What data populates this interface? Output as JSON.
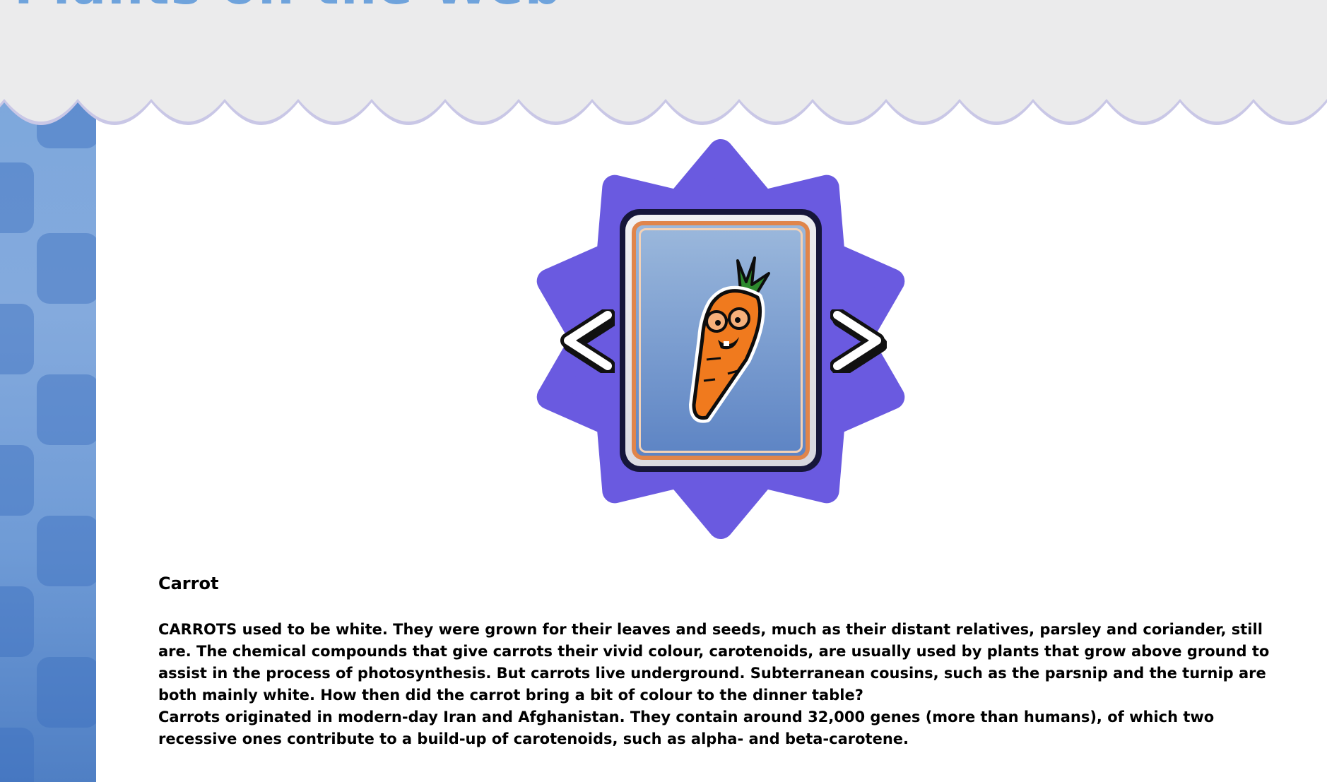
{
  "header": {
    "title": "Plants on the Web"
  },
  "gallery": {
    "prev_label": "<",
    "next_label": ">",
    "current_image": "carrot-character-icon",
    "star_color": "#6a5ae0"
  },
  "item": {
    "title": "Carrot",
    "paragraphs": [
      "CARROTS used to be white. They were grown for their leaves and seeds, much as their distant relatives, parsley and coriander, still are. The chemical compounds that give carrots their vivid colour, carotenoids, are usually used by plants that grow above ground to assist in the process of photosynthesis. But carrots live underground. Subterranean cousins, such as the parsnip and the turnip are both mainly white. How then did the carrot bring a bit of colour to the dinner table?",
      "Carrots originated in modern-day Iran and Afghanistan. They contain around 32,000 genes (more than humans), of which two recessive ones contribute to a build-up of carotenoids, such as alpha- and beta-carotene."
    ]
  }
}
